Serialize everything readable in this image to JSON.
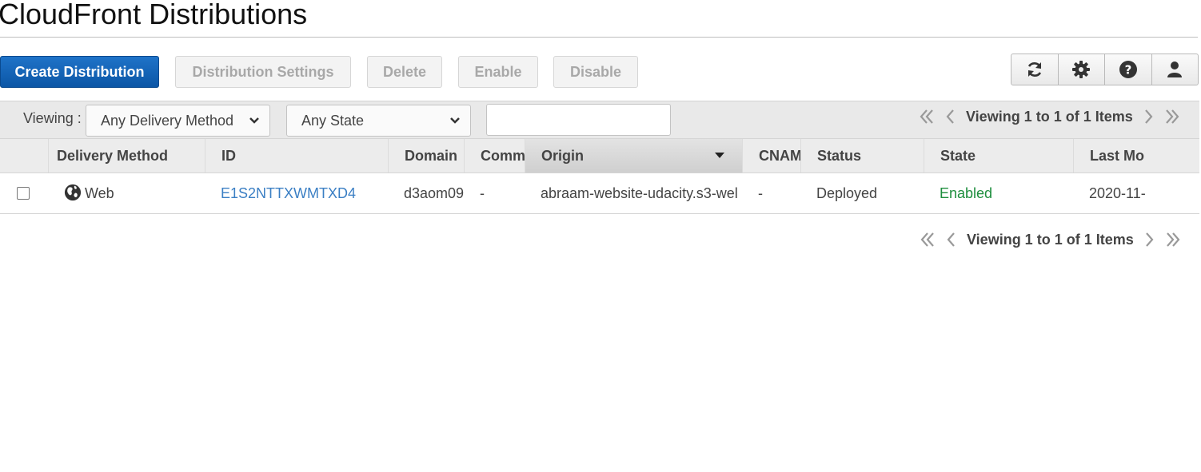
{
  "page": {
    "title": "CloudFront Distributions"
  },
  "toolbar": {
    "create": "Create Distribution",
    "settings": "Distribution Settings",
    "delete": "Delete",
    "enable": "Enable",
    "disable": "Disable"
  },
  "icons": [
    "refresh-icon",
    "gear-icon",
    "help-icon",
    "user-icon"
  ],
  "filters": {
    "viewing_label": "Viewing :",
    "delivery_method": "Any Delivery Method",
    "state": "Any State",
    "search_value": ""
  },
  "pager": {
    "text": "Viewing 1 to 1 of 1 Items"
  },
  "columns": [
    "Delivery Method",
    "ID",
    "Domain",
    "Comm",
    "Origin",
    "CNAM",
    "Status",
    "State",
    "Last Mo"
  ],
  "rows": [
    {
      "delivery_method": "Web",
      "id": "E1S2NTTXWMTXD4",
      "domain": "d3aom09",
      "comment": "-",
      "origin": "abraam-website-udacity.s3-wel",
      "cname": "-",
      "status": "Deployed",
      "state": "Enabled",
      "last_modified": "2020-11-"
    }
  ],
  "colors": {
    "primary": "#1f73c8",
    "link": "#3b7fc4",
    "enabled": "#1e8e3e"
  }
}
